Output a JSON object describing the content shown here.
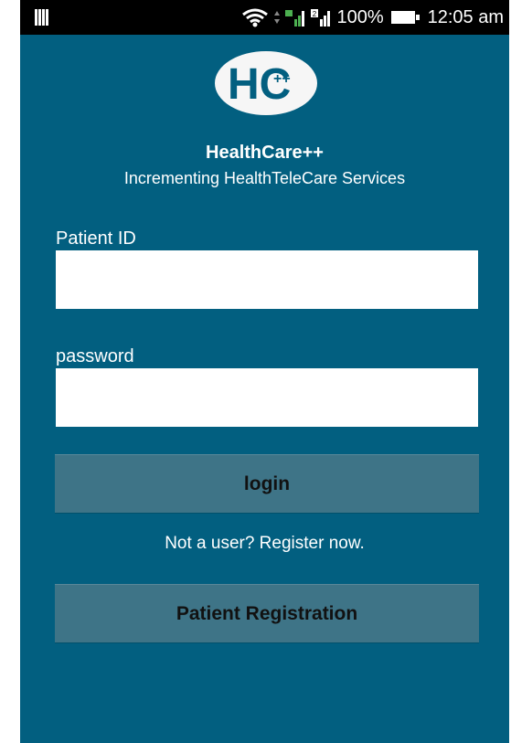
{
  "status_bar": {
    "battery_percent": "100%",
    "time": "12:05 am",
    "signal_label": "2"
  },
  "app": {
    "logo_text": "HC",
    "logo_superscript": "++",
    "title": "HealthCare++",
    "subtitle": "Incrementing HealthTeleCare Services"
  },
  "form": {
    "patient_id_label": "Patient ID",
    "patient_id_value": "",
    "password_label": "password",
    "password_value": ""
  },
  "buttons": {
    "login_label": "login",
    "register_prompt": "Not a user? Register now.",
    "registration_label": "Patient Registration"
  },
  "colors": {
    "background": "#025f80",
    "button": "#3e7487",
    "status_bar": "#000000",
    "field": "#ffffff"
  }
}
